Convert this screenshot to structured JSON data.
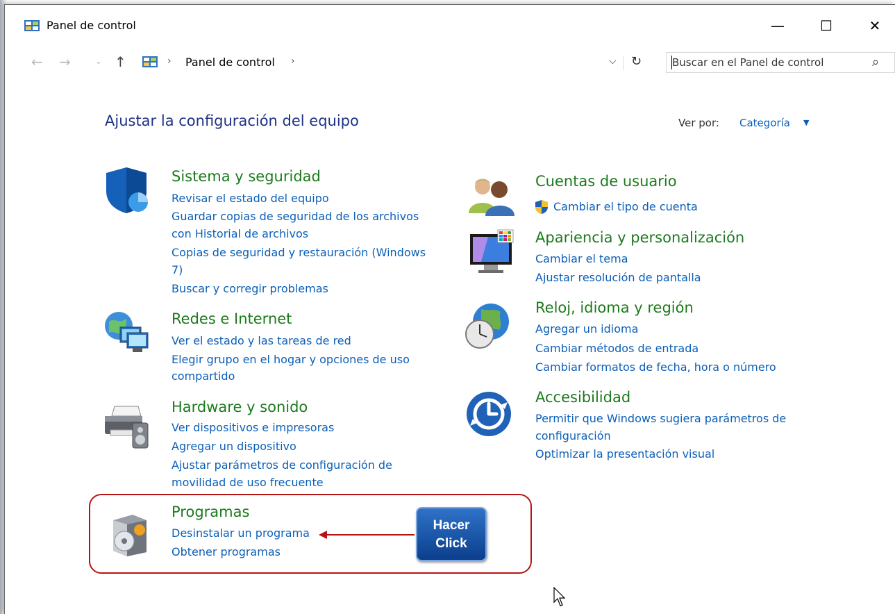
{
  "window": {
    "title": "Panel de control"
  },
  "window_controls": {
    "minimize": "—",
    "maximize": "☐",
    "close": "✕"
  },
  "nav": {
    "back": "←",
    "forward": "→",
    "recent": "⌄",
    "up": "↑"
  },
  "address": {
    "chevron": "›",
    "crumb": "Panel de control",
    "dropdown": "⌵",
    "refresh": "↻"
  },
  "search": {
    "placeholder": "Buscar en el Panel de control",
    "icon": "⌕"
  },
  "header": {
    "title": "Ajustar la configuración del equipo",
    "view_by_label": "Ver por:",
    "view_by_value": "Categoría",
    "view_by_arrow": "▼"
  },
  "categories": [
    {
      "title": "Sistema y seguridad",
      "icon": "shield-icon",
      "links": [
        "Revisar el estado del equipo",
        "Guardar copias de seguridad de los archivos",
        "con Historial de archivos",
        "Copias de seguridad y restauración (Windows",
        "7)",
        "Buscar y corregir problemas"
      ]
    },
    {
      "title": "Redes e Internet",
      "icon": "network-icon",
      "links": [
        "Ver el estado y las tareas de red",
        "Elegir grupo en el hogar y opciones de uso",
        "compartido"
      ]
    },
    {
      "title": "Hardware y sonido",
      "icon": "printer-icon",
      "links": [
        "Ver dispositivos e impresoras",
        "Agregar un dispositivo",
        "Ajustar parámetros de configuración de",
        "movilidad de uso frecuente"
      ]
    },
    {
      "title": "Programas",
      "icon": "programs-icon",
      "links": [
        "Desinstalar un programa",
        "Obtener programas"
      ]
    },
    {
      "title": "Cuentas de usuario",
      "icon": "users-icon",
      "links": [
        "Cambiar el tipo de cuenta"
      ]
    },
    {
      "title": "Apariencia y personalización",
      "icon": "monitor-icon",
      "links": [
        "Cambiar el tema",
        "Ajustar resolución de pantalla"
      ]
    },
    {
      "title": "Reloj, idioma y región",
      "icon": "clock-globe-icon",
      "links": [
        "Agregar un idioma",
        "Cambiar métodos de entrada",
        "Cambiar formatos de fecha, hora o número"
      ]
    },
    {
      "title": "Accesibilidad",
      "icon": "accessibility-icon",
      "links": [
        "Permitir que Windows sugiera parámetros de",
        "configuración",
        "Optimizar la presentación visual"
      ]
    }
  ],
  "annotation": {
    "line1": "Hacer",
    "line2": "Click"
  },
  "colors": {
    "title_green": "#1c7a1c",
    "link_blue": "#0b5fb8",
    "header_blue": "#1e3287",
    "highlight_red": "#b41414"
  }
}
